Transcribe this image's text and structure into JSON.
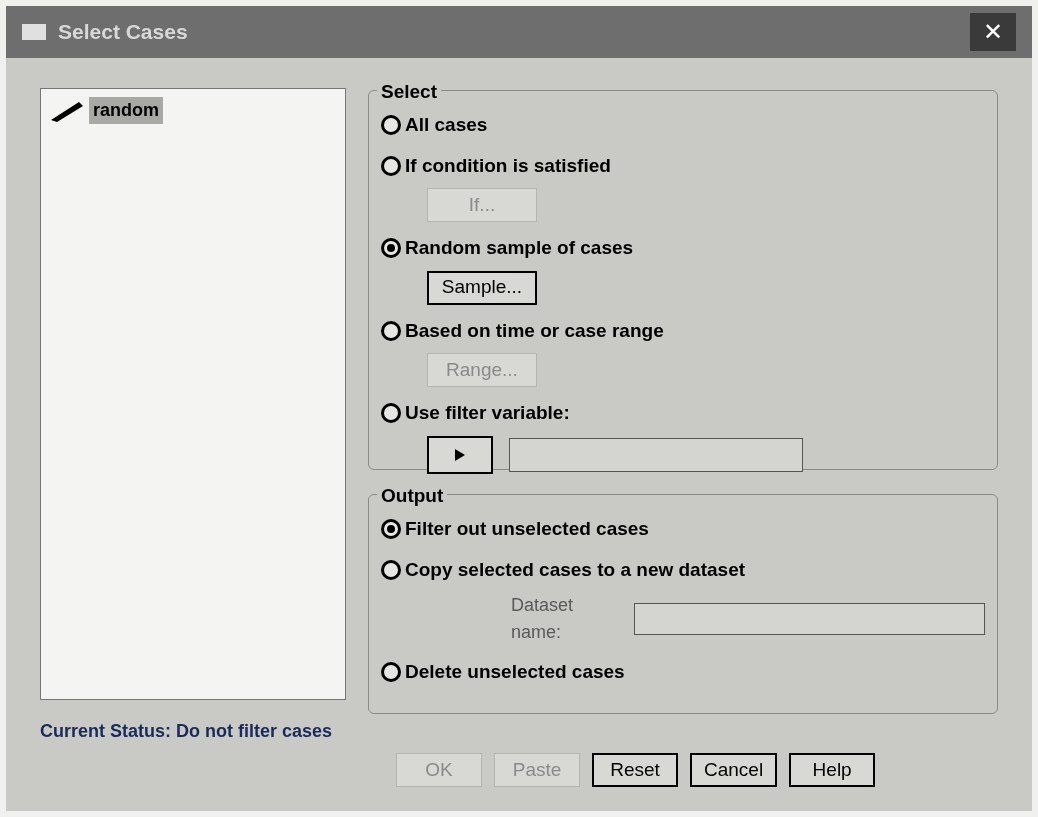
{
  "window": {
    "title": "Select Cases",
    "close": "✕"
  },
  "variables": [
    {
      "name": "random",
      "selected": true
    }
  ],
  "select": {
    "title": "Select",
    "options": [
      {
        "label": "All cases",
        "selected": false
      },
      {
        "label": "If condition is satisfied",
        "selected": false,
        "kind": "button",
        "button": {
          "label": "If...",
          "disabled": true
        }
      },
      {
        "label": "Random sample of cases",
        "selected": true,
        "kind": "button",
        "button": {
          "label": "Sample...",
          "disabled": false
        }
      },
      {
        "label": "Based on time or case range",
        "selected": false,
        "kind": "button",
        "button": {
          "label": "Range...",
          "disabled": true
        }
      },
      {
        "label": "Use filter variable:",
        "selected": false,
        "kind": "filter",
        "arrow_disabled": false
      }
    ]
  },
  "output": {
    "title": "Output",
    "options": [
      {
        "label": "Filter out unselected cases",
        "selected": true
      },
      {
        "label": "Copy selected cases to a new dataset",
        "selected": false,
        "kind": "dataset",
        "field_label": "Dataset name:",
        "field_disabled": true
      },
      {
        "label": "Delete unselected cases",
        "selected": false
      }
    ]
  },
  "status": "Current Status: Do not filter cases",
  "buttons": [
    {
      "label": "OK",
      "disabled": true
    },
    {
      "label": "Paste",
      "disabled": true
    },
    {
      "label": "Reset",
      "disabled": false
    },
    {
      "label": "Cancel",
      "disabled": false
    },
    {
      "label": "Help",
      "disabled": false
    }
  ]
}
